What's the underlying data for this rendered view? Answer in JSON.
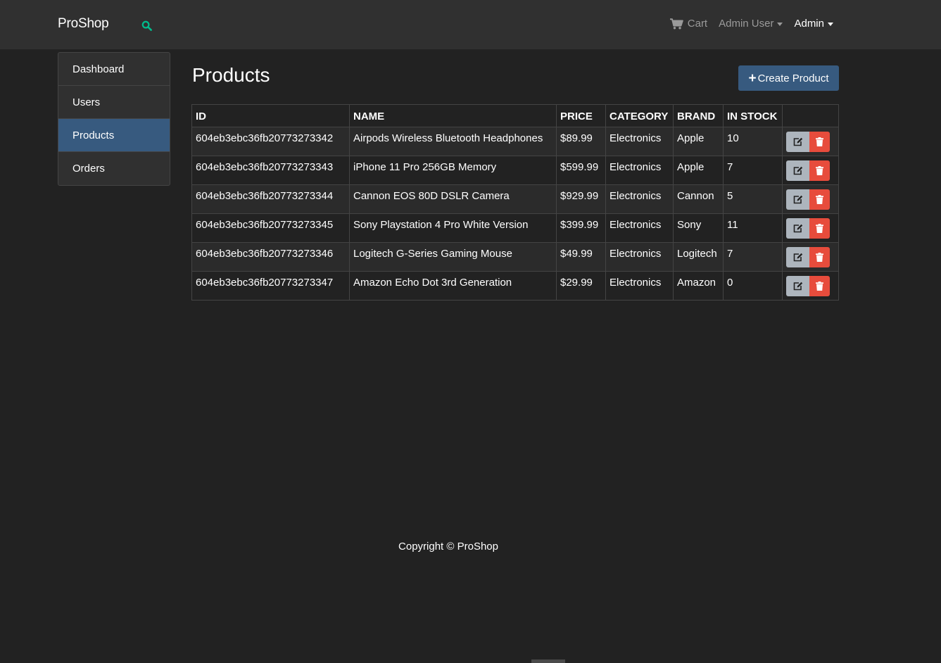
{
  "navbar": {
    "brand": "ProShop",
    "cart_label": "Cart",
    "user_menu_label": "Admin User",
    "admin_menu_label": "Admin",
    "icons": {
      "search": "search-icon",
      "cart": "cart-icon"
    },
    "accent_color": "#00bc8c"
  },
  "sidebar": {
    "items": [
      {
        "label": "Dashboard"
      },
      {
        "label": "Users"
      },
      {
        "label": "Products"
      },
      {
        "label": "Orders"
      }
    ],
    "active": "Products"
  },
  "main": {
    "title": "Products",
    "create_button_label": "Create Product",
    "table": {
      "headers": [
        "ID",
        "NAME",
        "PRICE",
        "CATEGORY",
        "BRAND",
        "IN STOCK",
        ""
      ],
      "rows": [
        {
          "id": "604eb3ebc36fb20773273342",
          "name": "Airpods Wireless Bluetooth Headphones",
          "price": "$89.99",
          "category": "Electronics",
          "brand": "Apple",
          "stock": "10"
        },
        {
          "id": "604eb3ebc36fb20773273343",
          "name": "iPhone 11 Pro 256GB Memory",
          "price": "$599.99",
          "category": "Electronics",
          "brand": "Apple",
          "stock": "7"
        },
        {
          "id": "604eb3ebc36fb20773273344",
          "name": "Cannon EOS 80D DSLR Camera",
          "price": "$929.99",
          "category": "Electronics",
          "brand": "Cannon",
          "stock": "5"
        },
        {
          "id": "604eb3ebc36fb20773273345",
          "name": "Sony Playstation 4 Pro White Version",
          "price": "$399.99",
          "category": "Electronics",
          "brand": "Sony",
          "stock": "11"
        },
        {
          "id": "604eb3ebc36fb20773273346",
          "name": "Logitech G-Series Gaming Mouse",
          "price": "$49.99",
          "category": "Electronics",
          "brand": "Logitech",
          "stock": "7"
        },
        {
          "id": "604eb3ebc36fb20773273347",
          "name": "Amazon Echo Dot 3rd Generation",
          "price": "$29.99",
          "category": "Electronics",
          "brand": "Amazon",
          "stock": "0"
        }
      ],
      "row_action_icons": {
        "edit": "edit-icon",
        "delete": "trash-icon"
      }
    }
  },
  "footer": {
    "text": "Copyright © ProShop"
  },
  "colors": {
    "background": "#222222",
    "navbar": "#303030",
    "primary": "#375a7f",
    "danger": "#e74c3c",
    "secondary": "#adb5bd"
  }
}
